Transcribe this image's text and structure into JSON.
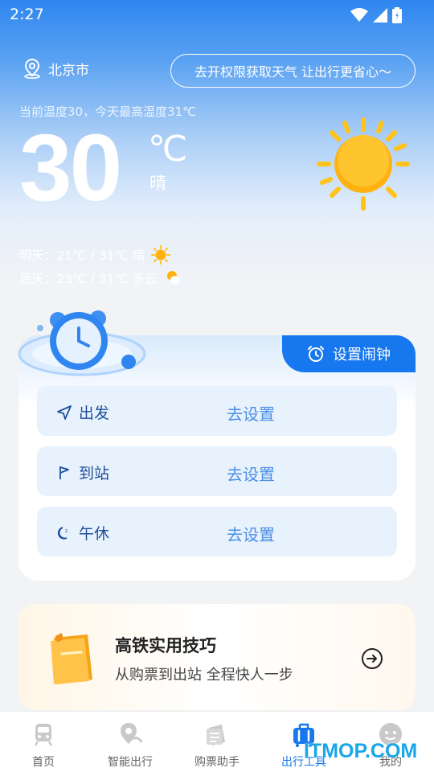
{
  "status_bar": {
    "time": "2:27"
  },
  "weather": {
    "location": "北京市",
    "permission_button": "去开权限获取天气 让出行更省心〜",
    "current_desc": "当前温度30，今天最高温度31℃",
    "temperature": "30",
    "unit": "℃",
    "condition": "晴",
    "forecast": [
      {
        "text": "明天：21℃ / 31℃  晴",
        "icon": "sun-icon"
      },
      {
        "text": "后天：23℃ / 31℃  多云",
        "icon": "partly-cloudy-icon"
      }
    ]
  },
  "alarm": {
    "tab_label": "设置闹钟",
    "rows": [
      {
        "label": "出发",
        "action": "去设置",
        "icon": "navigation-arrow-icon"
      },
      {
        "label": "到站",
        "action": "去设置",
        "icon": "flag-icon"
      },
      {
        "label": "午休",
        "action": "去设置",
        "icon": "moon-icon"
      }
    ]
  },
  "tips": {
    "title": "高铁实用技巧",
    "subtitle": "从购票到出站 全程快人一步"
  },
  "tabbar": {
    "items": [
      {
        "label": "首页",
        "icon": "train-icon",
        "active": false
      },
      {
        "label": "智能出行",
        "icon": "map-pin-icon",
        "active": false
      },
      {
        "label": "购票助手",
        "icon": "ticket-icon",
        "active": false
      },
      {
        "label": "出行工具",
        "icon": "luggage-icon",
        "active": true
      },
      {
        "label": "我的",
        "icon": "profile-icon",
        "active": false
      }
    ]
  },
  "watermark": "ITMOP.COM",
  "colors": {
    "accent": "#1677ee",
    "row_bg": "#e8f2fd",
    "action_text": "#4a8fe6"
  }
}
